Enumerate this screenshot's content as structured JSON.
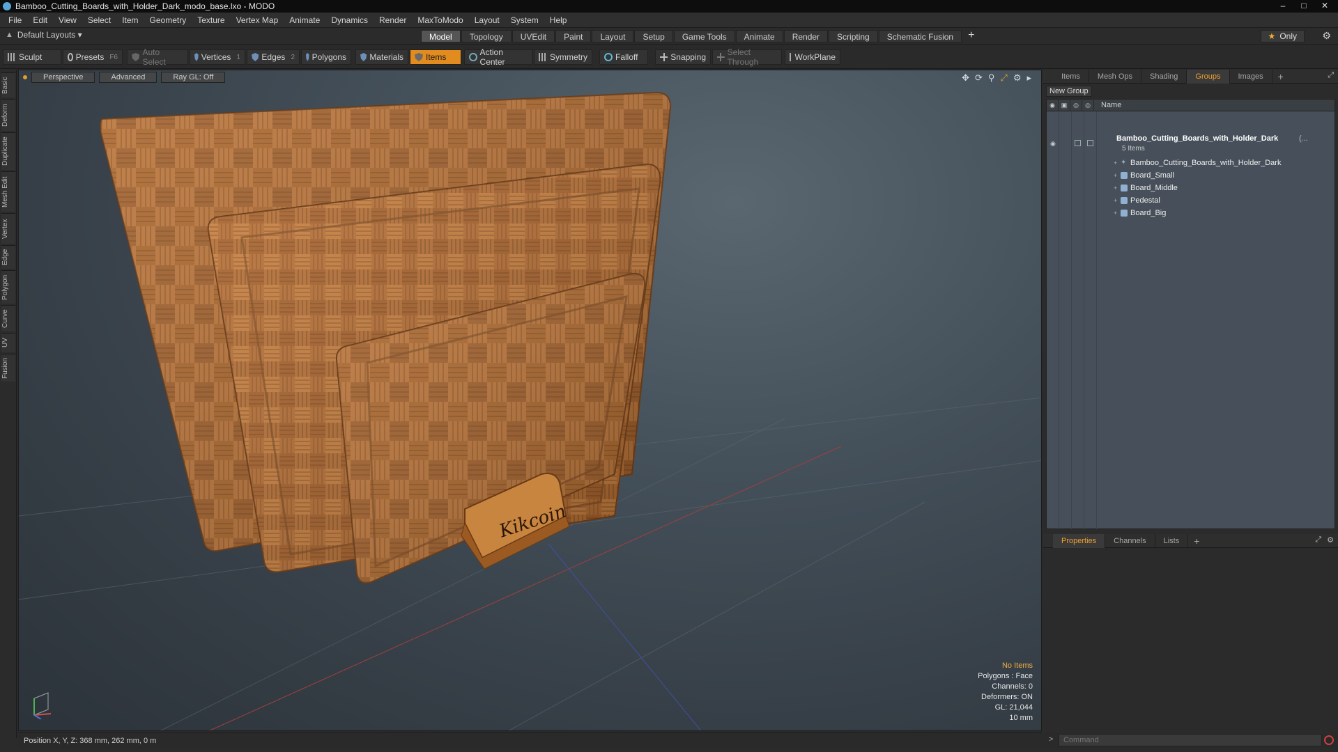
{
  "window": {
    "title": "Bamboo_Cutting_Boards_with_Holder_Dark_modo_base.lxo - MODO",
    "controls": [
      "–",
      "□",
      "✕"
    ]
  },
  "menu": [
    "File",
    "Edit",
    "View",
    "Select",
    "Item",
    "Geometry",
    "Texture",
    "Vertex Map",
    "Animate",
    "Dynamics",
    "Render",
    "MaxToModo",
    "Layout",
    "System",
    "Help"
  ],
  "layouts": {
    "label": "Default Layouts ▾"
  },
  "tabs": [
    {
      "label": "Model",
      "active": true
    },
    {
      "label": "Topology"
    },
    {
      "label": "UVEdit"
    },
    {
      "label": "Paint"
    },
    {
      "label": "Layout"
    },
    {
      "label": "Setup"
    },
    {
      "label": "Game Tools"
    },
    {
      "label": "Animate"
    },
    {
      "label": "Render"
    },
    {
      "label": "Scripting"
    },
    {
      "label": "Schematic Fusion"
    }
  ],
  "tab_plus": "+",
  "only_label": "Only",
  "toolbar": {
    "sculpt": "Sculpt",
    "presets": "Presets",
    "presets_key": "F6",
    "auto_select": "Auto Select",
    "vertices": "Vertices",
    "vertices_key": "1",
    "edges": "Edges",
    "edges_key": "2",
    "polygons": "Polygons",
    "materials": "Materials",
    "items": "Items",
    "action_center": "Action Center",
    "symmetry": "Symmetry",
    "falloff": "Falloff",
    "snapping": "Snapping",
    "select_through": "Select Through",
    "workplane": "WorkPlane"
  },
  "left_tabs": [
    "Basic",
    "Deform",
    "Duplicate",
    "Mesh Edit",
    "Vertex",
    "Edge",
    "Polygon",
    "Curve",
    "UV",
    "Fusion"
  ],
  "viewport": {
    "view": "Perspective",
    "shading": "Advanced",
    "raygl": "Ray GL: Off",
    "brand_text": "Kikcoin",
    "stats": {
      "no_items": "No Items",
      "polygons": "Polygons : Face",
      "channels": "Channels: 0",
      "deformers": "Deformers: ON",
      "gl": "GL: 21,044",
      "scale": "10 mm"
    }
  },
  "status": {
    "position": "Position X, Y, Z:  368 mm, 262 mm, 0 m"
  },
  "right_tabs": [
    {
      "label": "Items"
    },
    {
      "label": "Mesh Ops"
    },
    {
      "label": "Shading"
    },
    {
      "label": "Groups",
      "active": true
    },
    {
      "label": "Images"
    }
  ],
  "groups": {
    "new_group": "New Group",
    "col_name": "Name",
    "root": {
      "name": "Bamboo_Cutting_Boards_with_Holder_Dark",
      "suffix": "(...",
      "count": "5 Items"
    },
    "children": [
      {
        "name": "Bamboo_Cutting_Boards_with_Holder_Dark",
        "icon": "locator-icon"
      },
      {
        "name": "Board_Small",
        "icon": "mesh-icon"
      },
      {
        "name": "Board_Middle",
        "icon": "mesh-icon"
      },
      {
        "name": "Pedestal",
        "icon": "mesh-icon"
      },
      {
        "name": "Board_Big",
        "icon": "mesh-icon"
      }
    ]
  },
  "bottom_tabs": [
    {
      "label": "Properties",
      "active": true
    },
    {
      "label": "Channels"
    },
    {
      "label": "Lists"
    }
  ],
  "command": {
    "prompt": ">",
    "placeholder": "Command"
  },
  "colors": {
    "accent": "#e28b1f",
    "tab_active": "#f0a030",
    "viewport_bg": "#44505a",
    "wood": "#b06a2c"
  }
}
